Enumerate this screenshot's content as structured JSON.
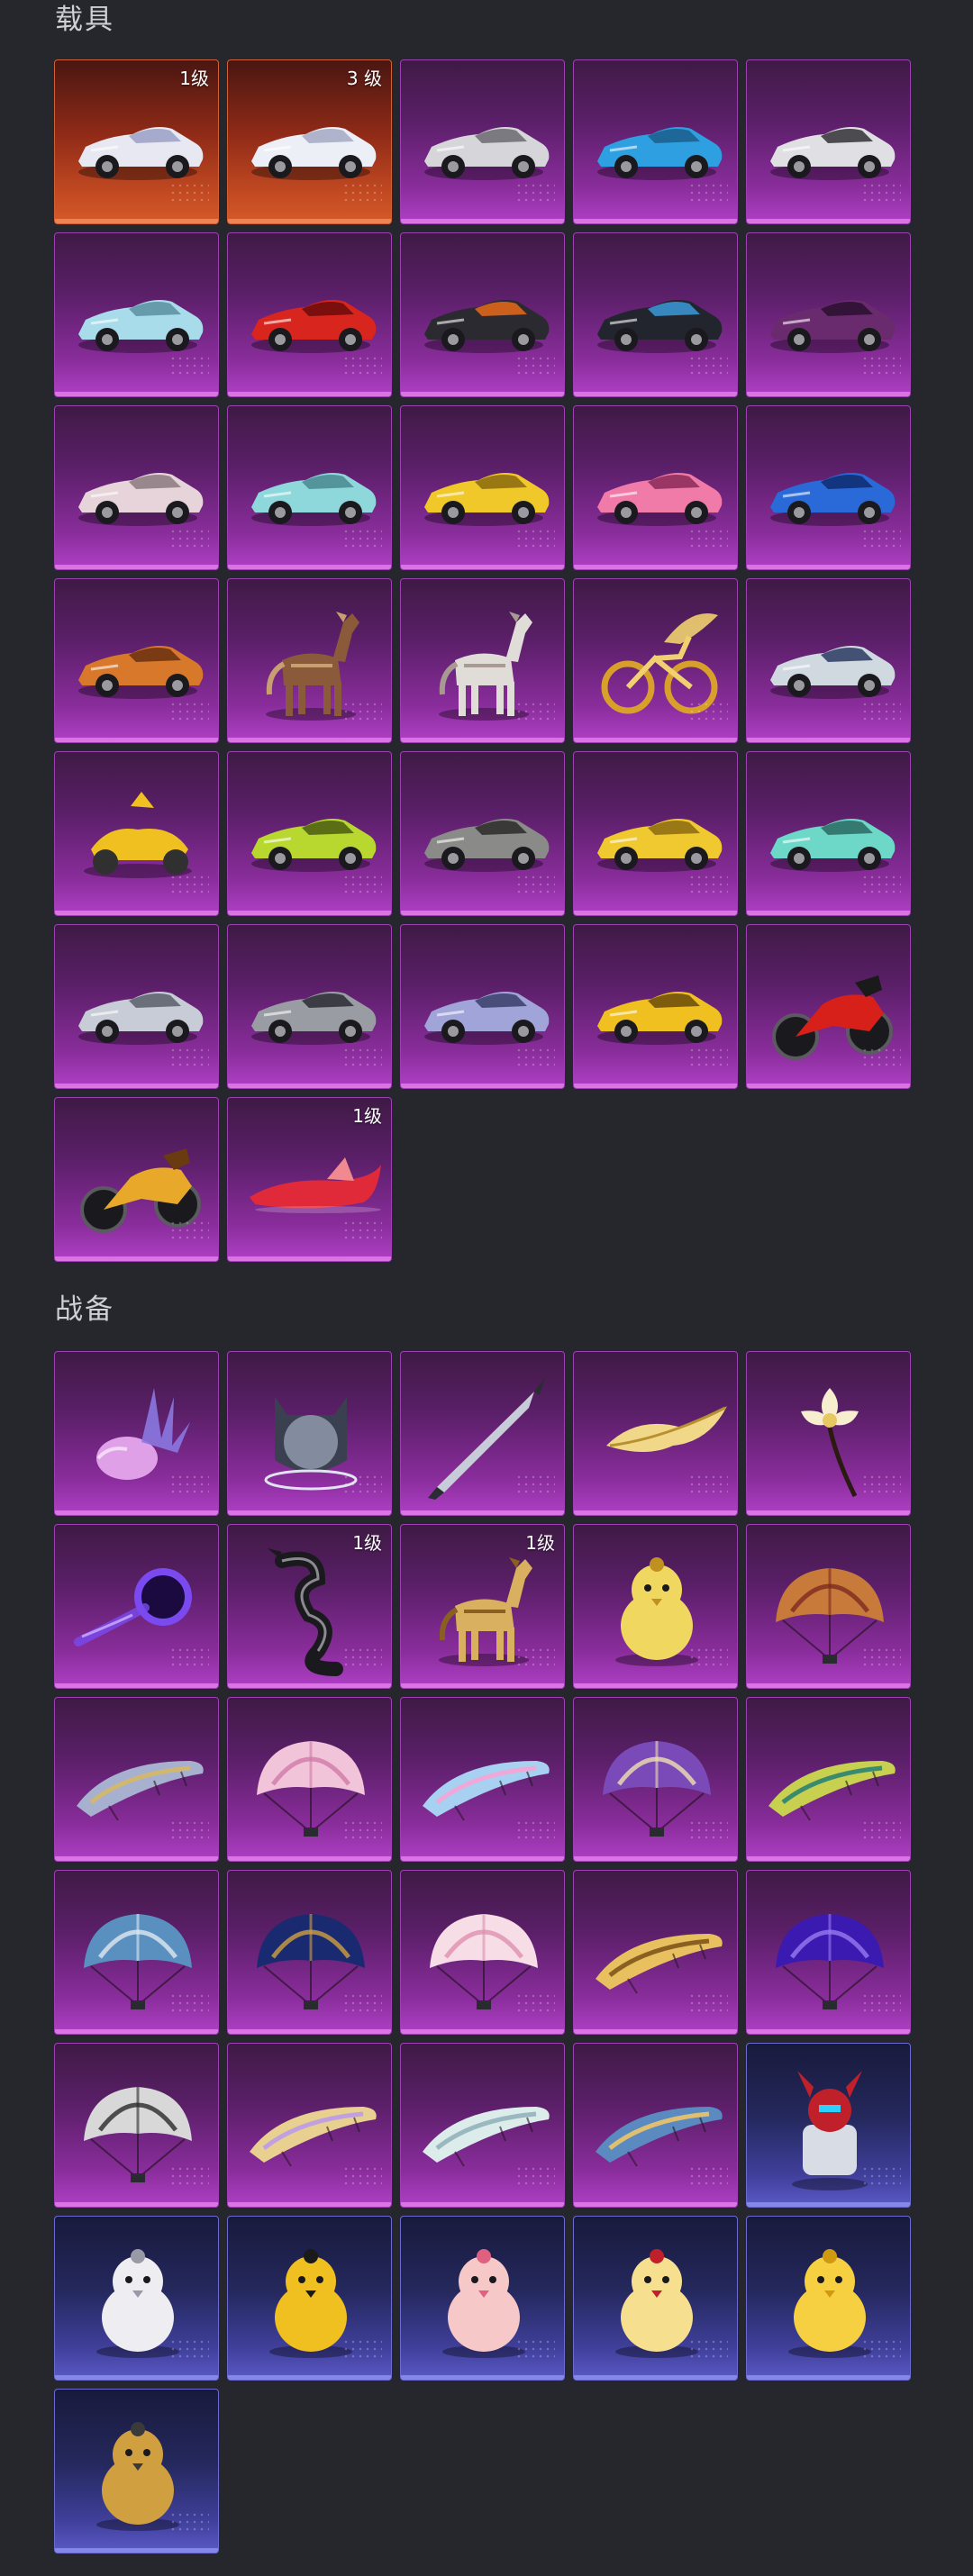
{
  "sections": [
    {
      "title": "载具",
      "items": [
        {
          "icon": "white-hypercar-icon",
          "kind": "car",
          "bg": "red",
          "body": "#e8e8f2",
          "accent": "#9aa0c8",
          "badge": "1级"
        },
        {
          "icon": "white-sports-car-icon",
          "kind": "car",
          "bg": "red",
          "body": "#eceff6",
          "accent": "#a5a9c4",
          "badge": "3 级"
        },
        {
          "icon": "silver-sports-car-icon",
          "kind": "car",
          "bg": "purple",
          "body": "#d6d6da",
          "accent": "#6a6a70"
        },
        {
          "icon": "blue-sports-car-icon",
          "kind": "car",
          "bg": "purple",
          "body": "#2e9fe0",
          "accent": "#1a5e8c"
        },
        {
          "icon": "silver-concept-car-icon",
          "kind": "car",
          "bg": "purple",
          "body": "#e0e0e4",
          "accent": "#303036"
        },
        {
          "icon": "light-blue-coupe-icon",
          "kind": "car",
          "bg": "purple",
          "body": "#a8dcea",
          "accent": "#5b8fa0"
        },
        {
          "icon": "red-supercar-icon",
          "kind": "car",
          "bg": "purple",
          "body": "#d8251d",
          "accent": "#6a0c0a"
        },
        {
          "icon": "black-orange-hypercar-icon",
          "kind": "car",
          "bg": "purple",
          "body": "#2a2a30",
          "accent": "#e86a1a"
        },
        {
          "icon": "black-blue-hypercar-icon",
          "kind": "car",
          "bg": "purple",
          "body": "#22242e",
          "accent": "#3a9ad8"
        },
        {
          "icon": "dark-purple-coupe-icon",
          "kind": "car",
          "bg": "purple",
          "body": "#6a2a6e",
          "accent": "#2a0f30"
        },
        {
          "icon": "pink-sedan-icon",
          "kind": "car",
          "bg": "purple",
          "body": "#e6d4da",
          "accent": "#8a7a80"
        },
        {
          "icon": "cyan-sedan-icon",
          "kind": "car",
          "bg": "purple",
          "body": "#8ed8dc",
          "accent": "#4a8a90"
        },
        {
          "icon": "yellow-coupe-icon",
          "kind": "car",
          "bg": "purple",
          "body": "#f0c82a",
          "accent": "#8a6a10"
        },
        {
          "icon": "pink-convertible-icon",
          "kind": "car",
          "bg": "purple",
          "body": "#f07aa8",
          "accent": "#8a2a58"
        },
        {
          "icon": "blue-roadster-icon",
          "kind": "car",
          "bg": "purple",
          "body": "#2a6ad8",
          "accent": "#0f2a70"
        },
        {
          "icon": "orange-convertible-icon",
          "kind": "car",
          "bg": "purple",
          "body": "#d8782a",
          "accent": "#6a2f10"
        },
        {
          "icon": "brown-horse-icon",
          "kind": "horse",
          "bg": "purple",
          "body": "#8a5a3a",
          "accent": "#c8a070"
        },
        {
          "icon": "white-horse-icon",
          "kind": "horse",
          "bg": "purple",
          "body": "#e0dcd8",
          "accent": "#a89a90"
        },
        {
          "icon": "golden-winged-bicycle-icon",
          "kind": "bike",
          "bg": "purple",
          "body": "#d8a02a",
          "accent": "#f0d070"
        },
        {
          "icon": "formula-racer-icon",
          "kind": "car",
          "bg": "purple",
          "body": "#d0d8e0",
          "accent": "#2a3a60"
        },
        {
          "icon": "yellow-kart-icon",
          "kind": "kart",
          "bg": "purple",
          "body": "#f0c020",
          "accent": "#303030"
        },
        {
          "icon": "lime-suv-icon",
          "kind": "car",
          "bg": "purple",
          "body": "#b8d830",
          "accent": "#4a5a10"
        },
        {
          "icon": "gray-offroad-suv-icon",
          "kind": "car",
          "bg": "purple",
          "body": "#8a8a88",
          "accent": "#2a2a2a"
        },
        {
          "icon": "yellow-beetle-icon",
          "kind": "car",
          "bg": "purple",
          "body": "#f0c830",
          "accent": "#8a6a10"
        },
        {
          "icon": "mint-coupe-icon",
          "kind": "car",
          "bg": "purple",
          "body": "#6ed8c8",
          "accent": "#2a6a60"
        },
        {
          "icon": "silver-gt-car-icon",
          "kind": "car",
          "bg": "purple",
          "body": "#c8ccd6",
          "accent": "#5a5e6a"
        },
        {
          "icon": "gray-carbon-car-icon",
          "kind": "car",
          "bg": "purple",
          "body": "#9a9ca4",
          "accent": "#2a2c34"
        },
        {
          "icon": "lilac-sports-car-icon",
          "kind": "car",
          "bg": "purple",
          "body": "#a0a4d8",
          "accent": "#3a3e6a"
        },
        {
          "icon": "yellow-taxi-car-icon",
          "kind": "car",
          "bg": "purple",
          "body": "#f0c020",
          "accent": "#6a4a0a"
        },
        {
          "icon": "red-motorcycle-icon",
          "kind": "moto",
          "bg": "purple",
          "body": "#d8201a",
          "accent": "#1a1a1a"
        },
        {
          "icon": "golden-motorcycle-icon",
          "kind": "moto",
          "bg": "purple",
          "body": "#e8a82a",
          "accent": "#6a3a10"
        },
        {
          "icon": "red-fish-boat-icon",
          "kind": "boat",
          "bg": "purple",
          "body": "#e02a3a",
          "accent": "#f08a90",
          "badge": "1级"
        }
      ]
    },
    {
      "title": "战备",
      "items": [
        {
          "icon": "crystal-pendant-icon",
          "kind": "crystal",
          "bg": "purple",
          "body": "#e0a0e8",
          "accent": "#8a78e0"
        },
        {
          "icon": "cat-helmet-icon",
          "kind": "helmet",
          "bg": "purple",
          "body": "#3a4050",
          "accent": "#c0c8e0"
        },
        {
          "icon": "sword-icon",
          "kind": "sword",
          "bg": "purple",
          "body": "#c8ccd8",
          "accent": "#2a2c34"
        },
        {
          "icon": "golden-feather-icon",
          "kind": "feather",
          "bg": "purple",
          "body": "#f0d888",
          "accent": "#b89030"
        },
        {
          "icon": "white-flower-icon",
          "kind": "flower",
          "bg": "purple",
          "body": "#f6eecf",
          "accent": "#2a1a10"
        },
        {
          "icon": "dark-portal-orb-icon",
          "kind": "orb",
          "bg": "purple",
          "body": "#1a0a40",
          "accent": "#7a4af0"
        },
        {
          "icon": "black-dragon-icon",
          "kind": "dragon",
          "bg": "purple",
          "body": "#1a1a1e",
          "accent": "#8a8a90",
          "badge": "1级"
        },
        {
          "icon": "golden-pegasus-icon",
          "kind": "horse",
          "bg": "purple",
          "body": "#d8b060",
          "accent": "#8a6020",
          "badge": "1级"
        },
        {
          "icon": "yellow-bat-creature-icon",
          "kind": "pet",
          "bg": "purple",
          "body": "#f0d860",
          "accent": "#c09020"
        },
        {
          "icon": "bronze-parachute-icon",
          "kind": "parachute",
          "bg": "purple",
          "body": "#c87a3a",
          "accent": "#7a2a20"
        },
        {
          "icon": "mosaic-glider-icon",
          "kind": "glider",
          "bg": "purple",
          "body": "#a8b0d0",
          "accent": "#d0b870"
        },
        {
          "icon": "pink-floral-parachute-icon",
          "kind": "parachute",
          "bg": "purple",
          "body": "#f2c4da",
          "accent": "#d07aa8"
        },
        {
          "icon": "pastel-glider-icon",
          "kind": "glider",
          "bg": "purple",
          "body": "#a8d0f0",
          "accent": "#f0a8d8"
        },
        {
          "icon": "purple-lantern-parachute-icon",
          "kind": "parachute",
          "bg": "purple",
          "body": "#7a4ab8",
          "accent": "#f0e0b0"
        },
        {
          "icon": "peacock-feather-glider-icon",
          "kind": "glider",
          "bg": "purple",
          "body": "#c8d050",
          "accent": "#3a8a70"
        },
        {
          "icon": "blue-wave-parachute-icon",
          "kind": "parachute",
          "bg": "purple",
          "body": "#5a90c0",
          "accent": "#e0e8f0"
        },
        {
          "icon": "starry-night-parachute-icon",
          "kind": "parachute",
          "bg": "purple",
          "body": "#1a2a70",
          "accent": "#d0a040"
        },
        {
          "icon": "pink-cat-parachute-icon",
          "kind": "parachute",
          "bg": "purple",
          "body": "#f6dde6",
          "accent": "#e090b0"
        },
        {
          "icon": "golden-leaf-glider-icon",
          "kind": "glider",
          "bg": "purple",
          "body": "#e8c060",
          "accent": "#8a6020"
        },
        {
          "icon": "galaxy-parachute-icon",
          "kind": "parachute",
          "bg": "purple",
          "body": "#3a1ab0",
          "accent": "#9a7af0"
        },
        {
          "icon": "marble-parachute-icon",
          "kind": "parachute",
          "bg": "purple",
          "body": "#d8d8d8",
          "accent": "#2a2a2a"
        },
        {
          "icon": "golden-drape-glider-icon",
          "kind": "glider",
          "bg": "purple",
          "body": "#e8d090",
          "accent": "#c0a0e0"
        },
        {
          "icon": "silver-white-glider-icon",
          "kind": "glider",
          "bg": "purple",
          "body": "#dcecea",
          "accent": "#9ab8c0"
        },
        {
          "icon": "blue-gold-glider-icon",
          "kind": "glider",
          "bg": "purple",
          "body": "#5a8ac0",
          "accent": "#e0c070"
        },
        {
          "icon": "red-horned-robot-icon",
          "kind": "robot",
          "bg": "blue",
          "body": "#c0202a",
          "accent": "#d8dce4"
        },
        {
          "icon": "white-chubby-bird-icon",
          "kind": "pet",
          "bg": "blue",
          "body": "#eeeef2",
          "accent": "#9a9aa6"
        },
        {
          "icon": "cool-chick-sunglasses-icon",
          "kind": "pet",
          "bg": "blue",
          "body": "#f0c020",
          "accent": "#1a1a1a"
        },
        {
          "icon": "pink-bird-character-icon",
          "kind": "pet",
          "bg": "blue",
          "body": "#f6c8c8",
          "accent": "#e06080"
        },
        {
          "icon": "yellow-round-chick-icon",
          "kind": "pet",
          "bg": "blue",
          "body": "#f6e090",
          "accent": "#c0202a"
        },
        {
          "icon": "yellow-duck-plush-icon",
          "kind": "pet",
          "bg": "blue",
          "body": "#f6d040",
          "accent": "#d09a10"
        },
        {
          "icon": "helmet-chick-icon",
          "kind": "pet",
          "bg": "blue",
          "body": "#d0a040",
          "accent": "#3a3a3a"
        }
      ]
    }
  ]
}
